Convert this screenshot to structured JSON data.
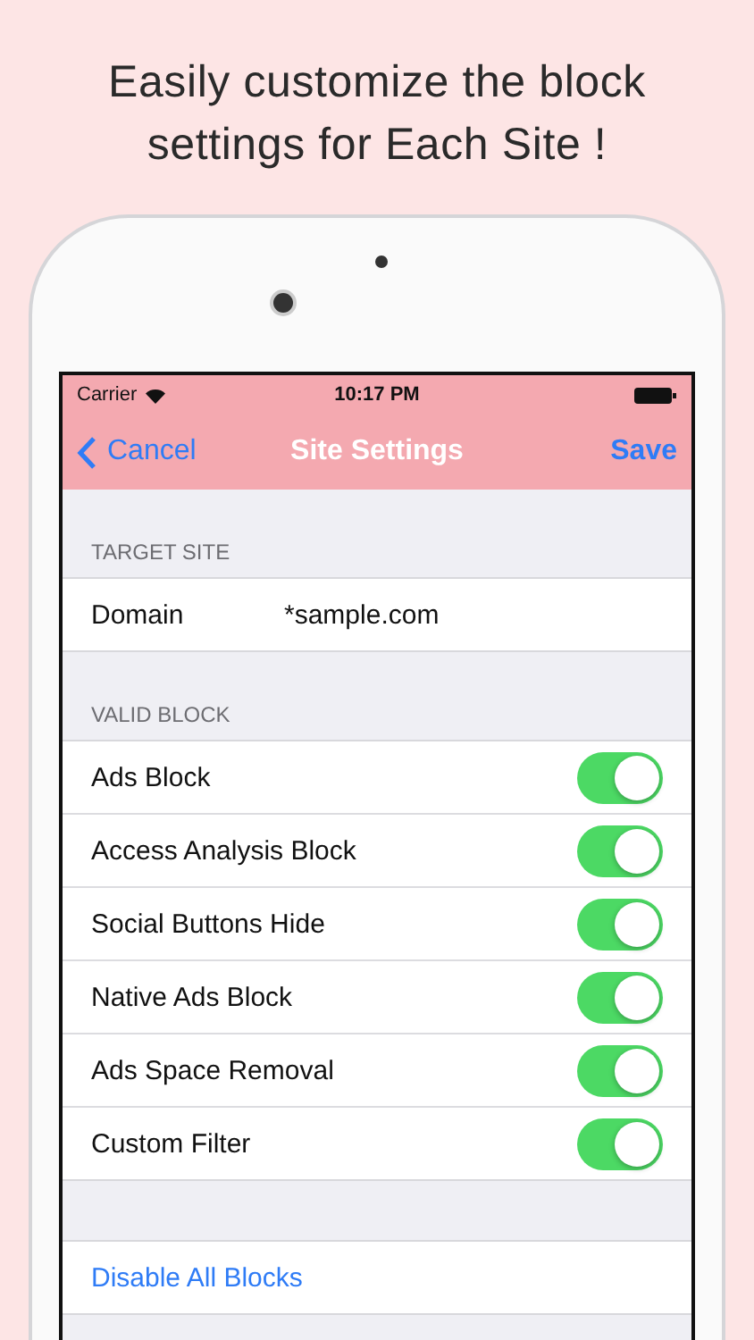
{
  "headline": "Easily customize the block settings for Each Site !",
  "status_bar": {
    "carrier": "Carrier",
    "time": "10:17 PM"
  },
  "nav_bar": {
    "back": "Cancel",
    "title": "Site Settings",
    "action": "Save"
  },
  "sections": [
    {
      "header": "TARGET SITE",
      "rows": [
        {
          "kind": "field",
          "label": "Domain",
          "value": "*sample.com"
        }
      ]
    },
    {
      "header": "VALID BLOCK",
      "rows": [
        {
          "kind": "toggle",
          "label": "Ads Block",
          "on": true
        },
        {
          "kind": "toggle",
          "label": "Access Analysis Block",
          "on": true
        },
        {
          "kind": "toggle",
          "label": "Social Buttons Hide",
          "on": true
        },
        {
          "kind": "toggle",
          "label": "Native Ads Block",
          "on": true
        },
        {
          "kind": "toggle",
          "label": "Ads Space Removal",
          "on": true
        },
        {
          "kind": "toggle",
          "label": "Custom Filter",
          "on": true
        }
      ]
    },
    {
      "rows": [
        {
          "kind": "action",
          "label": "Disable All Blocks"
        }
      ]
    }
  ]
}
